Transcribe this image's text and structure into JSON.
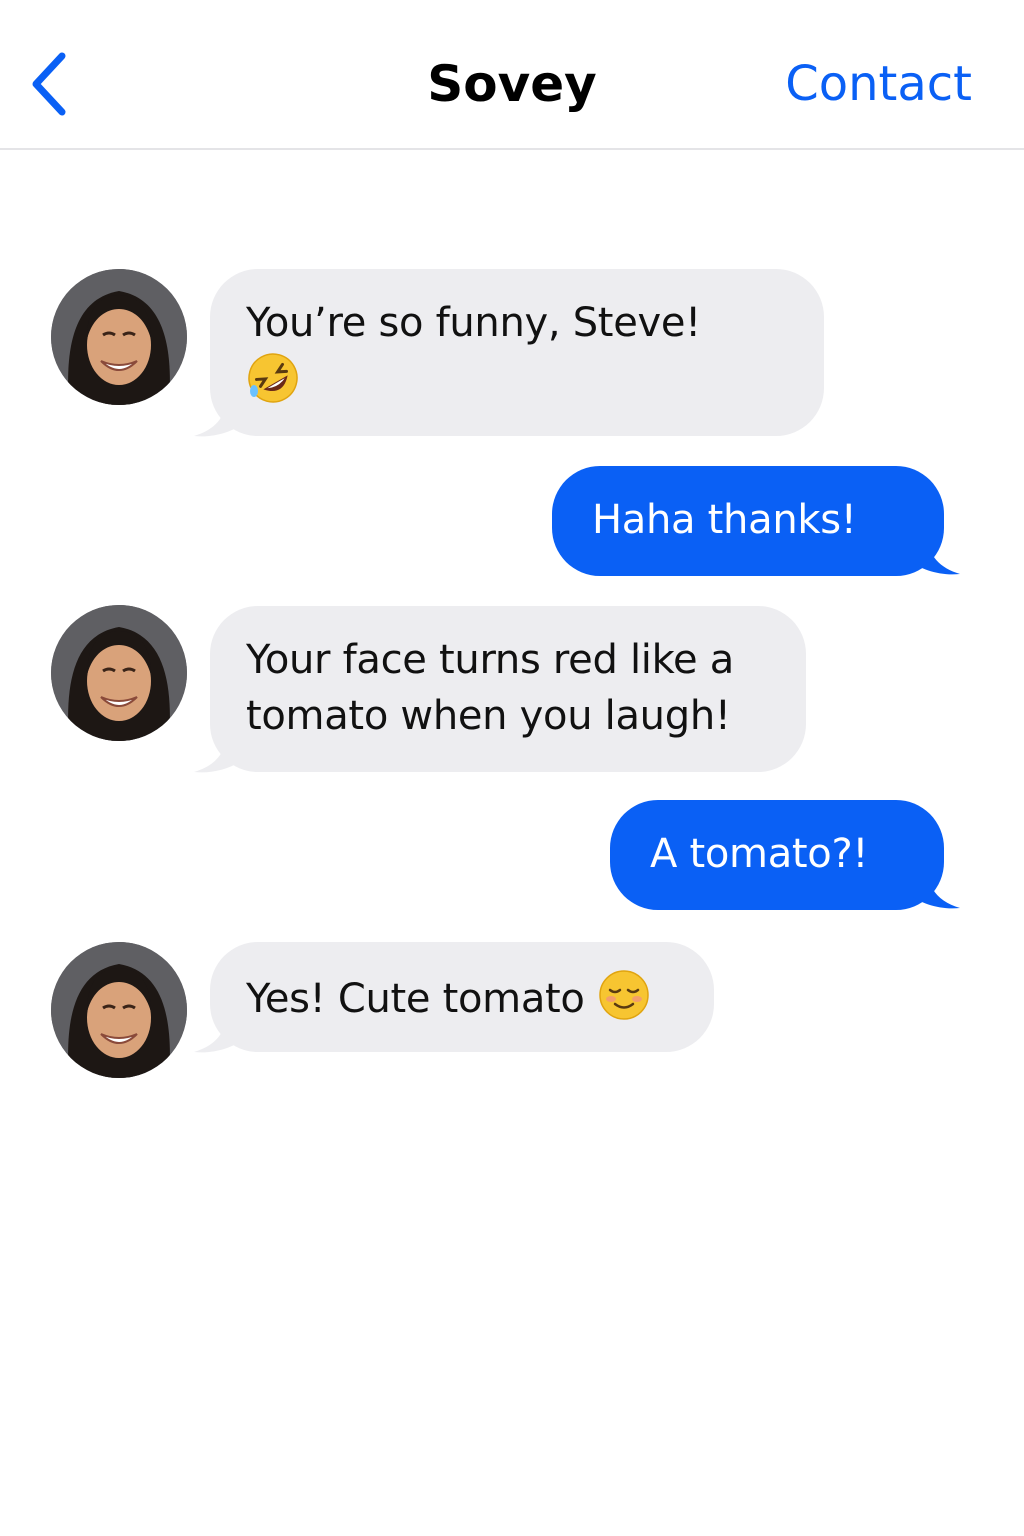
{
  "header": {
    "back_icon": "chevron-left-icon",
    "title": "Sovey",
    "contact_label": "Contact"
  },
  "colors": {
    "accent": "#0a60f5",
    "incoming_bubble": "#ededf0",
    "outgoing_text": "#ffffff"
  },
  "messages": [
    {
      "direction": "incoming",
      "line1": "You’re so funny, Steve!",
      "emoji": "rolling-on-the-floor-laughing-emoji"
    },
    {
      "direction": "outgoing",
      "text": "Haha thanks!"
    },
    {
      "direction": "incoming",
      "line1": "Your face turns red like a",
      "line2": "tomato when you laugh!"
    },
    {
      "direction": "outgoing",
      "text": "A tomato?!"
    },
    {
      "direction": "incoming",
      "text": "Yes! Cute tomato",
      "emoji": "smiling-face-emoji"
    }
  ]
}
